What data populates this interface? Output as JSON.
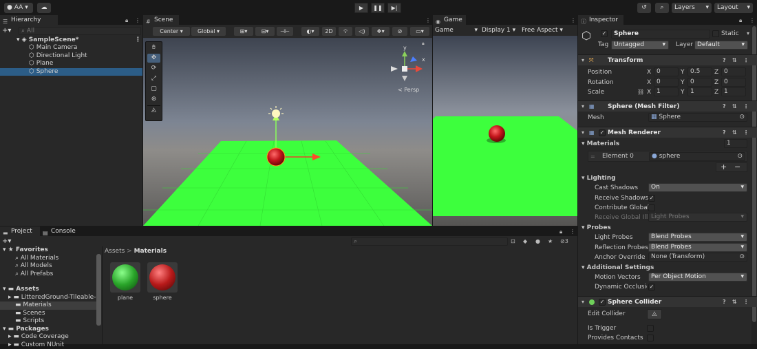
{
  "toolbar": {
    "account": "AA",
    "layers": "Layers",
    "layout": "Layout"
  },
  "hierarchy": {
    "tab": "Hierarchy",
    "search_placeholder": "All",
    "scene": "SampleScene*",
    "items": [
      {
        "label": "Main Camera"
      },
      {
        "label": "Directional Light"
      },
      {
        "label": "Plane"
      },
      {
        "label": "Sphere"
      }
    ]
  },
  "scene_view": {
    "tab": "Scene",
    "pivot": "Center",
    "space": "Global",
    "mode2d": "2D",
    "persp": "< Persp",
    "axis_x": "x",
    "axis_y": "y"
  },
  "game_view": {
    "tab": "Game",
    "mode": "Game",
    "display": "Display 1",
    "aspect": "Free Aspect"
  },
  "project": {
    "tab_project": "Project",
    "tab_console": "Console",
    "favorites": "Favorites",
    "fav_items": [
      {
        "label": "All Materials"
      },
      {
        "label": "All Models"
      },
      {
        "label": "All Prefabs"
      }
    ],
    "assets": "Assets",
    "asset_items": [
      {
        "label": "LitteredGround-Tileable-"
      },
      {
        "label": "Materials"
      },
      {
        "label": "Scenes"
      },
      {
        "label": "Scripts"
      }
    ],
    "packages": "Packages",
    "package_items": [
      {
        "label": "Code Coverage"
      },
      {
        "label": "Custom NUnit"
      }
    ],
    "breadcrumb_root": "Assets",
    "breadcrumb_sep": ">",
    "breadcrumb_leaf": "Materials",
    "hidden_count": "3",
    "materials": [
      {
        "label": "plane",
        "color": "#2aa52a"
      },
      {
        "label": "sphere",
        "color": "#b81a1a"
      }
    ]
  },
  "inspector": {
    "tab": "Inspector",
    "object_name": "Sphere",
    "static_label": "Static",
    "tag_label": "Tag",
    "tag_value": "Untagged",
    "layer_label": "Layer",
    "layer_value": "Default",
    "transform": {
      "title": "Transform",
      "rows": [
        {
          "label": "Position",
          "x": "0",
          "y": "0.5",
          "z": "0"
        },
        {
          "label": "Rotation",
          "x": "0",
          "y": "0",
          "z": "0"
        },
        {
          "label": "Scale",
          "x": "1",
          "y": "1",
          "z": "1"
        }
      ],
      "axis_x": "X",
      "axis_y": "Y",
      "axis_z": "Z"
    },
    "mesh_filter": {
      "title": "Sphere (Mesh Filter)",
      "mesh_label": "Mesh",
      "mesh_value": "Sphere"
    },
    "mesh_renderer": {
      "title": "Mesh Renderer",
      "materials_label": "Materials",
      "materials_count": "1",
      "element_label": "Element 0",
      "element_value": "sphere",
      "plus": "+",
      "minus": "−",
      "lighting": "Lighting",
      "cast_shadows_label": "Cast Shadows",
      "cast_shadows_value": "On",
      "receive_shadows_label": "Receive Shadows",
      "contribute_gi_label": "Contribute Global",
      "receive_gi_label": "Receive Global Illi",
      "receive_gi_value": "Light Probes",
      "probes": "Probes",
      "light_probes_label": "Light Probes",
      "light_probes_value": "Blend Probes",
      "reflection_probes_label": "Reflection Probes",
      "reflection_probes_value": "Blend Probes",
      "anchor_label": "Anchor Override",
      "anchor_value": "None (Transform)",
      "additional": "Additional Settings",
      "motion_label": "Motion Vectors",
      "motion_value": "Per Object Motion",
      "occlusion_label": "Dynamic Occlusic"
    },
    "sphere_collider": {
      "title": "Sphere Collider",
      "edit_label": "Edit Collider",
      "trigger_label": "Is Trigger",
      "contacts_label": "Provides Contacts"
    }
  },
  "colors": {
    "selection": "#2c5d87",
    "ground_green": "#3dff3d",
    "sphere_red": "#c4161c",
    "accent_blue": "#4c7fff"
  }
}
